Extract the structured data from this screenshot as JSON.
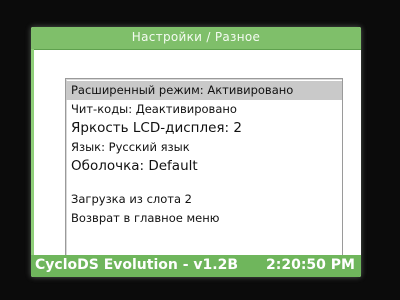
{
  "title_bar": {
    "title": "Настройки / Разное"
  },
  "menu": {
    "items": [
      {
        "label": "Расширенный режим: Активировано",
        "selected": true
      },
      {
        "label": "Чит-коды: Деактивировано",
        "selected": false
      },
      {
        "label": "Яркость LCD-дисплея: 2",
        "selected": false
      },
      {
        "label": "Язык: Русский язык",
        "selected": false
      },
      {
        "label": "Оболочка: Default",
        "selected": false
      },
      {
        "label": "Загрузка из слота 2",
        "selected": false
      },
      {
        "label": "Возврат в главное меню",
        "selected": false
      }
    ]
  },
  "status_bar": {
    "app_version": "CycloDS Evolution - v1.2B",
    "clock": "2:20:50 PM"
  },
  "colors": {
    "title_bar_bg": "#7fbf6a",
    "status_bar_bg": "#6fb65c",
    "selected_row_bg": "#c9c9c9"
  }
}
